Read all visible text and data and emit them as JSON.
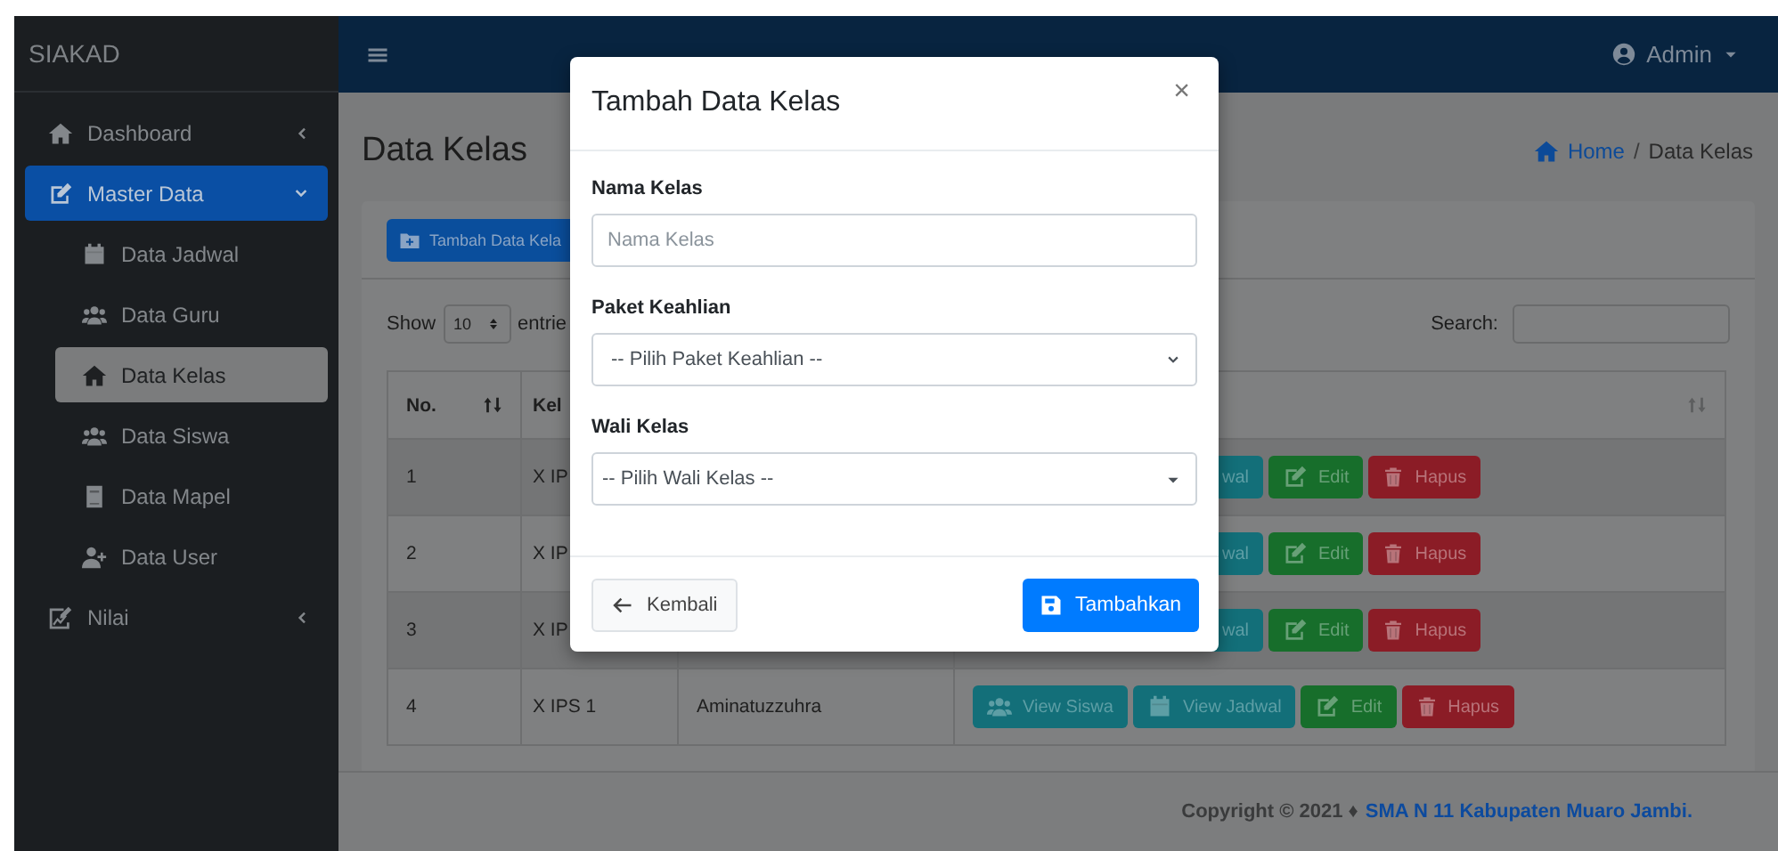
{
  "sidebar": {
    "brand": "SIAKAD",
    "items": [
      {
        "label": "Dashboard",
        "selected": false,
        "expanded": false
      },
      {
        "label": "Master Data",
        "selected": true,
        "expanded": true,
        "children": [
          {
            "label": "Data Jadwal",
            "selected": false
          },
          {
            "label": "Data Guru",
            "selected": false
          },
          {
            "label": "Data Kelas",
            "selected": true
          },
          {
            "label": "Data Siswa",
            "selected": false
          },
          {
            "label": "Data Mapel",
            "selected": false
          },
          {
            "label": "Data User",
            "selected": false
          }
        ]
      },
      {
        "label": "Nilai",
        "selected": false,
        "expanded": false
      }
    ]
  },
  "topbar": {
    "user": "Admin"
  },
  "page": {
    "title": "Data Kelas",
    "breadcrumb": [
      "Home",
      "Data Kelas"
    ],
    "breadcrumb_separator": "/"
  },
  "card": {
    "add_button": "Tambah Data Kela",
    "show_label": "Show",
    "page_size": "10",
    "entries_label": "entrie",
    "search_label": "Search:"
  },
  "table": {
    "columns": [
      "No.",
      "Kel"
    ],
    "rows": [
      {
        "cells": [
          "1",
          "X IP"
        ],
        "actions": [
          {
            "kind": "jadwal",
            "label": "wal"
          },
          {
            "kind": "edit",
            "label": "Edit"
          },
          {
            "kind": "delete",
            "label": "Hapus"
          }
        ]
      },
      {
        "cells": [
          "2",
          "X IP"
        ],
        "actions": [
          {
            "kind": "jadwal",
            "label": "wal"
          },
          {
            "kind": "edit",
            "label": "Edit"
          },
          {
            "kind": "delete",
            "label": "Hapus"
          }
        ]
      },
      {
        "cells": [
          "3",
          "X IP"
        ],
        "actions": [
          {
            "kind": "jadwal",
            "label": "wal"
          },
          {
            "kind": "edit",
            "label": "Edit"
          },
          {
            "kind": "delete",
            "label": "Hapus"
          }
        ]
      },
      {
        "cells": [
          "4",
          "X IPS 1",
          "Aminatuzzuhra"
        ],
        "actions": [
          {
            "kind": "siswa",
            "label": "View Siswa"
          },
          {
            "kind": "jadwal",
            "label": "View Jadwal"
          },
          {
            "kind": "edit",
            "label": "Edit"
          },
          {
            "kind": "delete",
            "label": "Hapus"
          }
        ]
      }
    ]
  },
  "footer": {
    "copyright": "Copyright © 2021 ♦",
    "link": "SMA N 11 Kabupaten Muaro Jambi."
  },
  "modal": {
    "title": "Tambah Data Kelas",
    "close": "×",
    "fields": [
      {
        "kind": "text",
        "label": "Nama Kelas",
        "placeholder": "Nama Kelas"
      },
      {
        "kind": "select",
        "label": "Paket Keahlian",
        "value": "-- Pilih Paket Keahlian --"
      },
      {
        "kind": "combo",
        "label": "Wali Kelas",
        "value": "-- Pilih Wali Kelas --"
      }
    ],
    "back_button": "Kembali",
    "submit_button": "Tambahkan"
  }
}
